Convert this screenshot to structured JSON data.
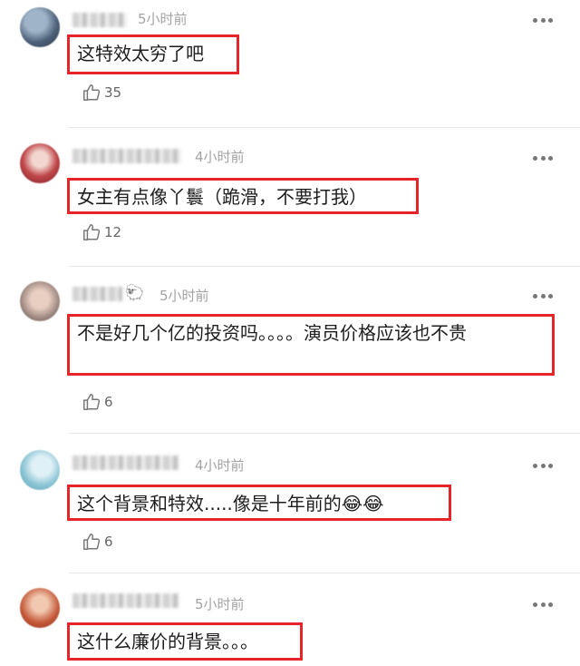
{
  "comments": [
    {
      "time": "5小时前",
      "text": "这特效太穷了吧",
      "likes": "35"
    },
    {
      "time": "4小时前",
      "text": "女主有点像丫鬟（跪滑，不要打我）",
      "likes": "12"
    },
    {
      "time": "5小时前",
      "text": "不是好几个亿的投资吗。。。。演员价格应该也不贵",
      "likes": "6",
      "emoji": "🐑"
    },
    {
      "time": "4小时前",
      "text": "这个背景和特效.....像是十年前的😂😂",
      "likes": "6"
    },
    {
      "time": "5小时前",
      "text": "这什么廉价的背景。。。",
      "likes": ""
    }
  ],
  "icons": {
    "more": "more-dots-icon",
    "like": "thumbs-up-icon"
  },
  "colors": {
    "highlight_border": "#e5252a",
    "timestamp": "#a3a3a3"
  }
}
